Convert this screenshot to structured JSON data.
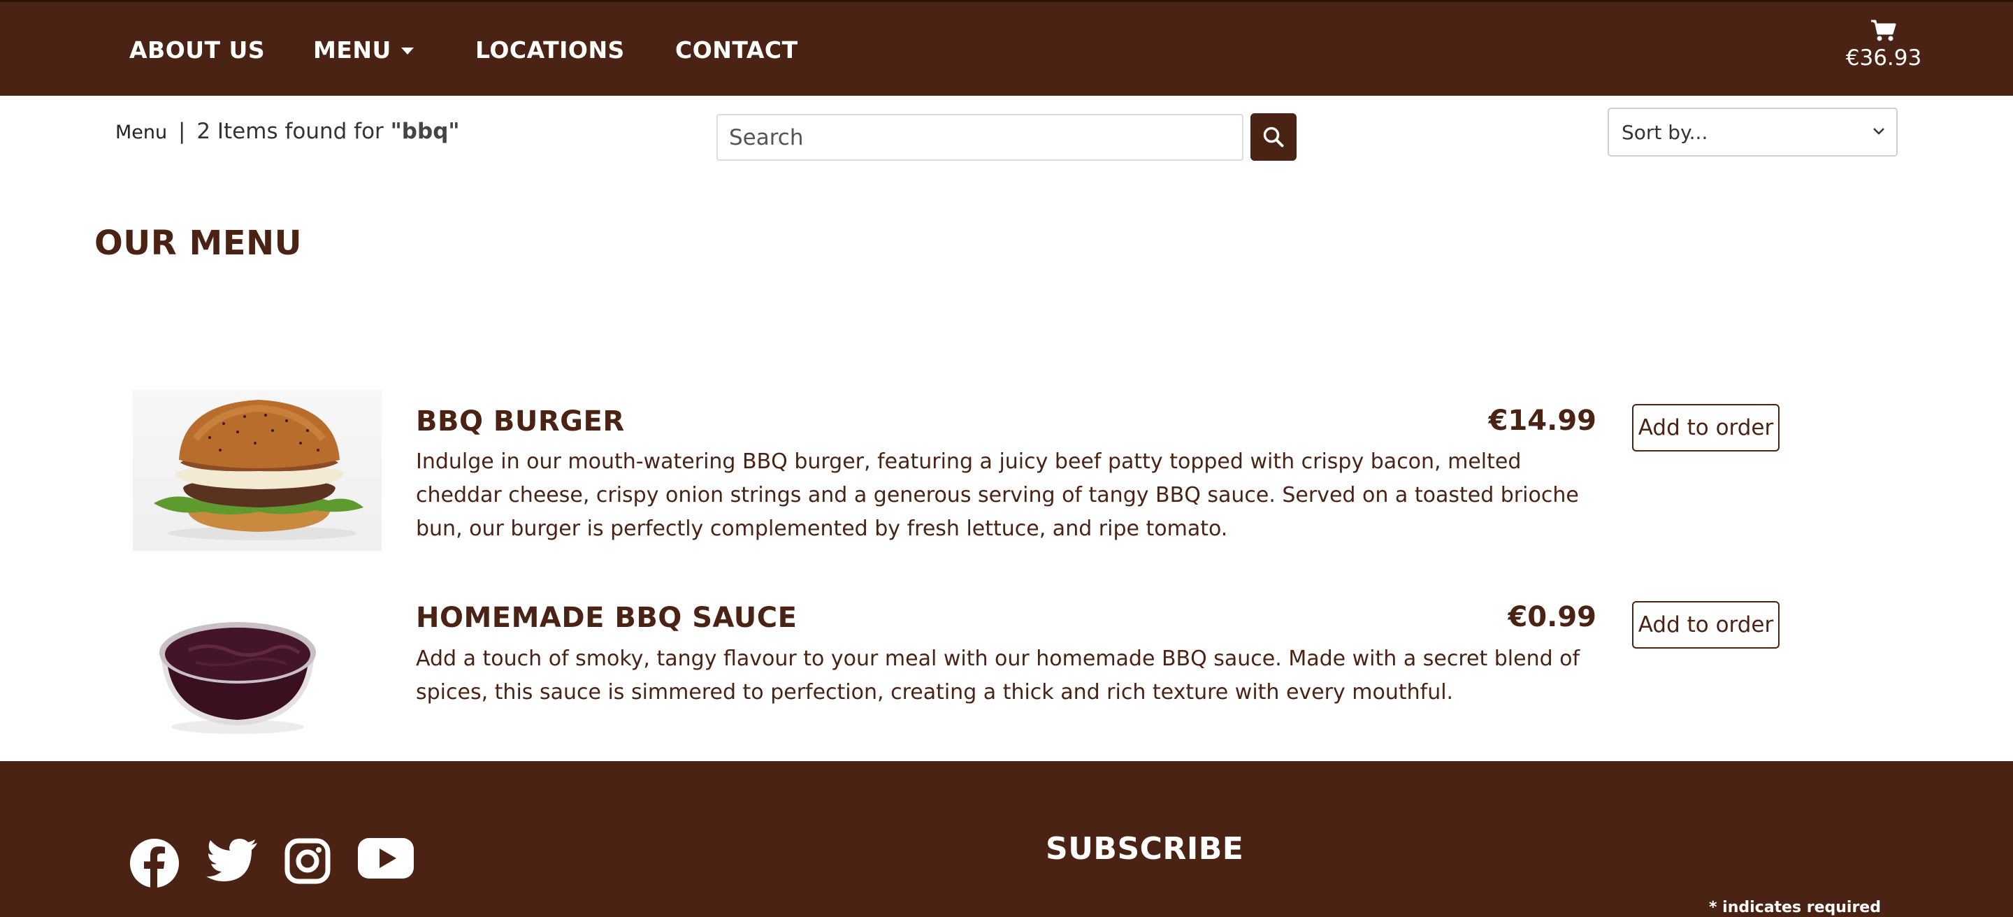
{
  "nav": {
    "links": [
      {
        "label": "ABOUT US"
      },
      {
        "label": "MENU"
      },
      {
        "label": "LOCATIONS"
      },
      {
        "label": "CONTACT"
      }
    ],
    "cart": {
      "icon": "shopping-cart-icon",
      "total": "€36.93"
    }
  },
  "toolbar": {
    "breadcrumb": "Menu",
    "separator": "|",
    "results_text": "2 Items found for",
    "query": "\"bbq\"",
    "search_placeholder": "Search",
    "search_value": "",
    "search_button_icon": "search-icon",
    "sort_label": "Sort by..."
  },
  "page_title": "OUR MENU",
  "items": [
    {
      "name": "BBQ BURGER",
      "price": "€14.99",
      "description": "Indulge in our mouth-watering BBQ burger, featuring a juicy beef patty topped with crispy bacon, melted cheddar cheese, crispy onion strings and a generous serving of tangy BBQ sauce. Served on a toasted brioche bun, our burger is perfectly complemented by fresh lettuce, and ripe tomato.",
      "button": "Add to order",
      "image": "bbq-burger-photo"
    },
    {
      "name": "HOMEMADE BBQ SAUCE",
      "price": "€0.99",
      "description": "Add a touch of smoky, tangy flavour to your meal with our homemade BBQ sauce. Made with a secret blend of spices, this sauce is simmered to perfection, creating a thick and rich texture with every mouthful.",
      "button": "Add to order",
      "image": "bbq-sauce-photo"
    }
  ],
  "footer": {
    "social_icons": [
      "facebook-icon",
      "twitter-icon",
      "instagram-icon",
      "youtube-icon"
    ],
    "subscribe_title": "SUBSCRIBE",
    "required_note": "* indicates required"
  },
  "colors": {
    "brand_brown": "#4a2314",
    "white": "#ffffff"
  }
}
